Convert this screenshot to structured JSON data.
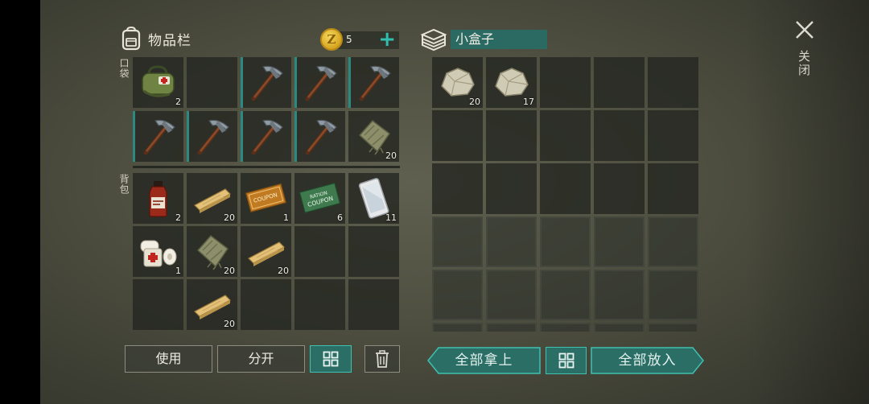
{
  "inventory": {
    "title": "物品栏",
    "coins": "5",
    "coin_symbol": "Z",
    "plus": "+",
    "pocket_label": "口袋",
    "backpack_label": "背包",
    "pocket_slots": [
      {
        "item": "first-aid-bag",
        "qty": "2"
      },
      {
        "item": "",
        "qty": ""
      },
      {
        "item": "pickaxe",
        "qty": ""
      },
      {
        "item": "pickaxe",
        "qty": ""
      },
      {
        "item": "pickaxe",
        "qty": ""
      },
      {
        "item": "pickaxe",
        "qty": ""
      },
      {
        "item": "pickaxe",
        "qty": ""
      },
      {
        "item": "pickaxe",
        "qty": ""
      },
      {
        "item": "pickaxe",
        "qty": ""
      },
      {
        "item": "cloth-rag",
        "qty": "20"
      }
    ],
    "backpack_slots": [
      {
        "item": "medicine-bottle",
        "qty": "2"
      },
      {
        "item": "wood-plank",
        "qty": "20"
      },
      {
        "item": "orange-coupon",
        "qty": "1"
      },
      {
        "item": "ration-coupon",
        "qty": "6"
      },
      {
        "item": "smartphone",
        "qty": "11"
      },
      {
        "item": "bandages",
        "qty": "1"
      },
      {
        "item": "cloth-rag",
        "qty": "20"
      },
      {
        "item": "wood-plank",
        "qty": "20"
      },
      {
        "item": "",
        "qty": ""
      },
      {
        "item": "",
        "qty": ""
      },
      {
        "item": "",
        "qty": ""
      },
      {
        "item": "wood-plank",
        "qty": "20"
      },
      {
        "item": "",
        "qty": ""
      },
      {
        "item": "",
        "qty": ""
      },
      {
        "item": "",
        "qty": ""
      }
    ],
    "coupon_text": "RATION\nCOUPON",
    "use_label": "使用",
    "split_label": "分开"
  },
  "container": {
    "title": "小盒子",
    "slots": [
      {
        "item": "stone",
        "qty": "20"
      },
      {
        "item": "stone",
        "qty": "17"
      }
    ],
    "take_all_label": "全部拿上",
    "put_all_label": "全部放入"
  },
  "close_label": "关闭",
  "colors": {
    "accent": "#2fbfae",
    "teal_fill": "#2a6e66",
    "slot_bg": "#222520"
  }
}
